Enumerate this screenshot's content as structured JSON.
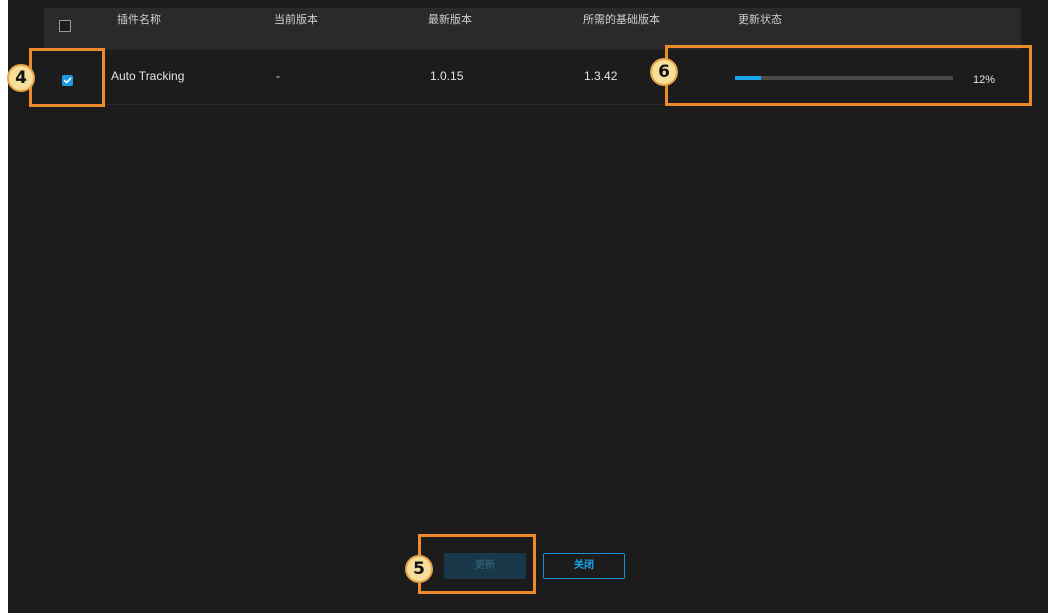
{
  "table": {
    "headers": {
      "plugin_name": "插件名称",
      "current_version": "当前版本",
      "latest_version": "最新版本",
      "required_base_version": "所需的基础版本",
      "update_status": "更新状态"
    },
    "rows": [
      {
        "checked": true,
        "plugin_name": "Auto Tracking",
        "current_version": "-",
        "latest_version": "1.0.15",
        "required_base_version": "1.3.42",
        "progress": 0.12,
        "progress_label": "12%"
      }
    ]
  },
  "buttons": {
    "update_label": "更新",
    "close_label": "关闭"
  },
  "callouts": {
    "four": "4",
    "five": "5",
    "six": "6"
  },
  "colors": {
    "accent": "#1aa7f0",
    "callout_border": "#ef8a2c",
    "callout_badge": "#f6df9a",
    "panel_bg": "#1c1c1c",
    "header_bg": "#2a2a2a"
  }
}
